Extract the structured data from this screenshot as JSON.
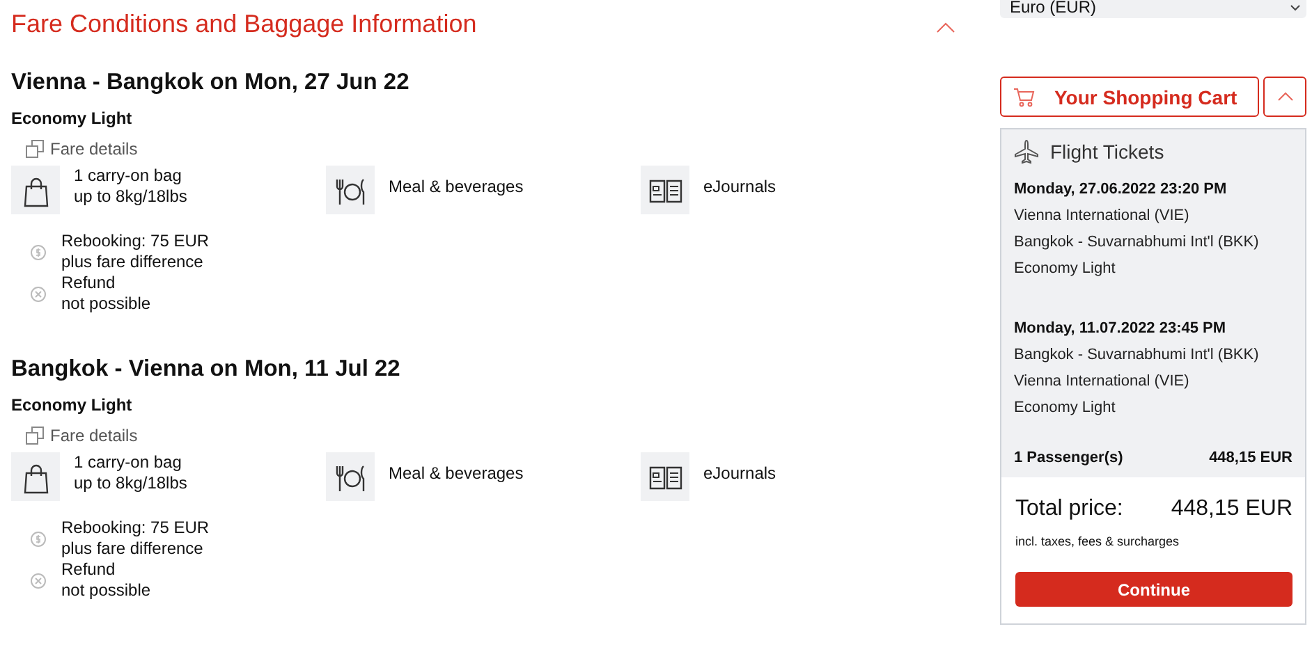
{
  "section": {
    "title": "Fare Conditions and Baggage Information",
    "expanded": true
  },
  "flights": [
    {
      "heading": "Vienna - Bangkok on Mon, 27 Jun 22",
      "fare": "Economy Light",
      "details_link": "Fare details",
      "services": [
        {
          "kind": "bag",
          "text": "1 carry-on bag\nup to 8kg/18lbs"
        },
        {
          "kind": "meal",
          "text": "Meal & beverages"
        },
        {
          "kind": "journal",
          "text": "eJournals"
        }
      ],
      "conditions": [
        {
          "kind": "fee",
          "text": "Rebooking: 75 EUR\nplus fare difference"
        },
        {
          "kind": "none",
          "text": "Refund\nnot possible"
        }
      ]
    },
    {
      "heading": "Bangkok - Vienna on Mon, 11 Jul 22",
      "fare": "Economy Light",
      "details_link": "Fare details",
      "services": [
        {
          "kind": "bag",
          "text": "1 carry-on bag\nup to 8kg/18lbs"
        },
        {
          "kind": "meal",
          "text": "Meal & beverages"
        },
        {
          "kind": "journal",
          "text": "eJournals"
        }
      ],
      "conditions": [
        {
          "kind": "fee",
          "text": "Rebooking: 75 EUR\nplus fare difference"
        },
        {
          "kind": "none",
          "text": "Refund\nnot possible"
        }
      ]
    }
  ],
  "currency": {
    "value": "Euro (EUR)"
  },
  "cart": {
    "title": "Your Shopping Cart",
    "expanded": true,
    "heading": "Flight Tickets",
    "legs": [
      {
        "datetime": "Monday, 27.06.2022 23:20 PM",
        "from": "Vienna International (VIE)",
        "to": "Bangkok - Suvarnabhumi Int'l (BKK)",
        "fare": "Economy Light"
      },
      {
        "datetime": "Monday, 11.07.2022 23:45 PM",
        "from": "Bangkok - Suvarnabhumi Int'l (BKK)",
        "to": "Vienna International (VIE)",
        "fare": "Economy Light"
      }
    ],
    "passengers": "1 Passenger(s)",
    "passengers_price": "448,15 EUR",
    "total_label": "Total price:",
    "total": "448,15 EUR",
    "note": "incl. taxes, fees & surcharges",
    "continue": "Continue"
  }
}
